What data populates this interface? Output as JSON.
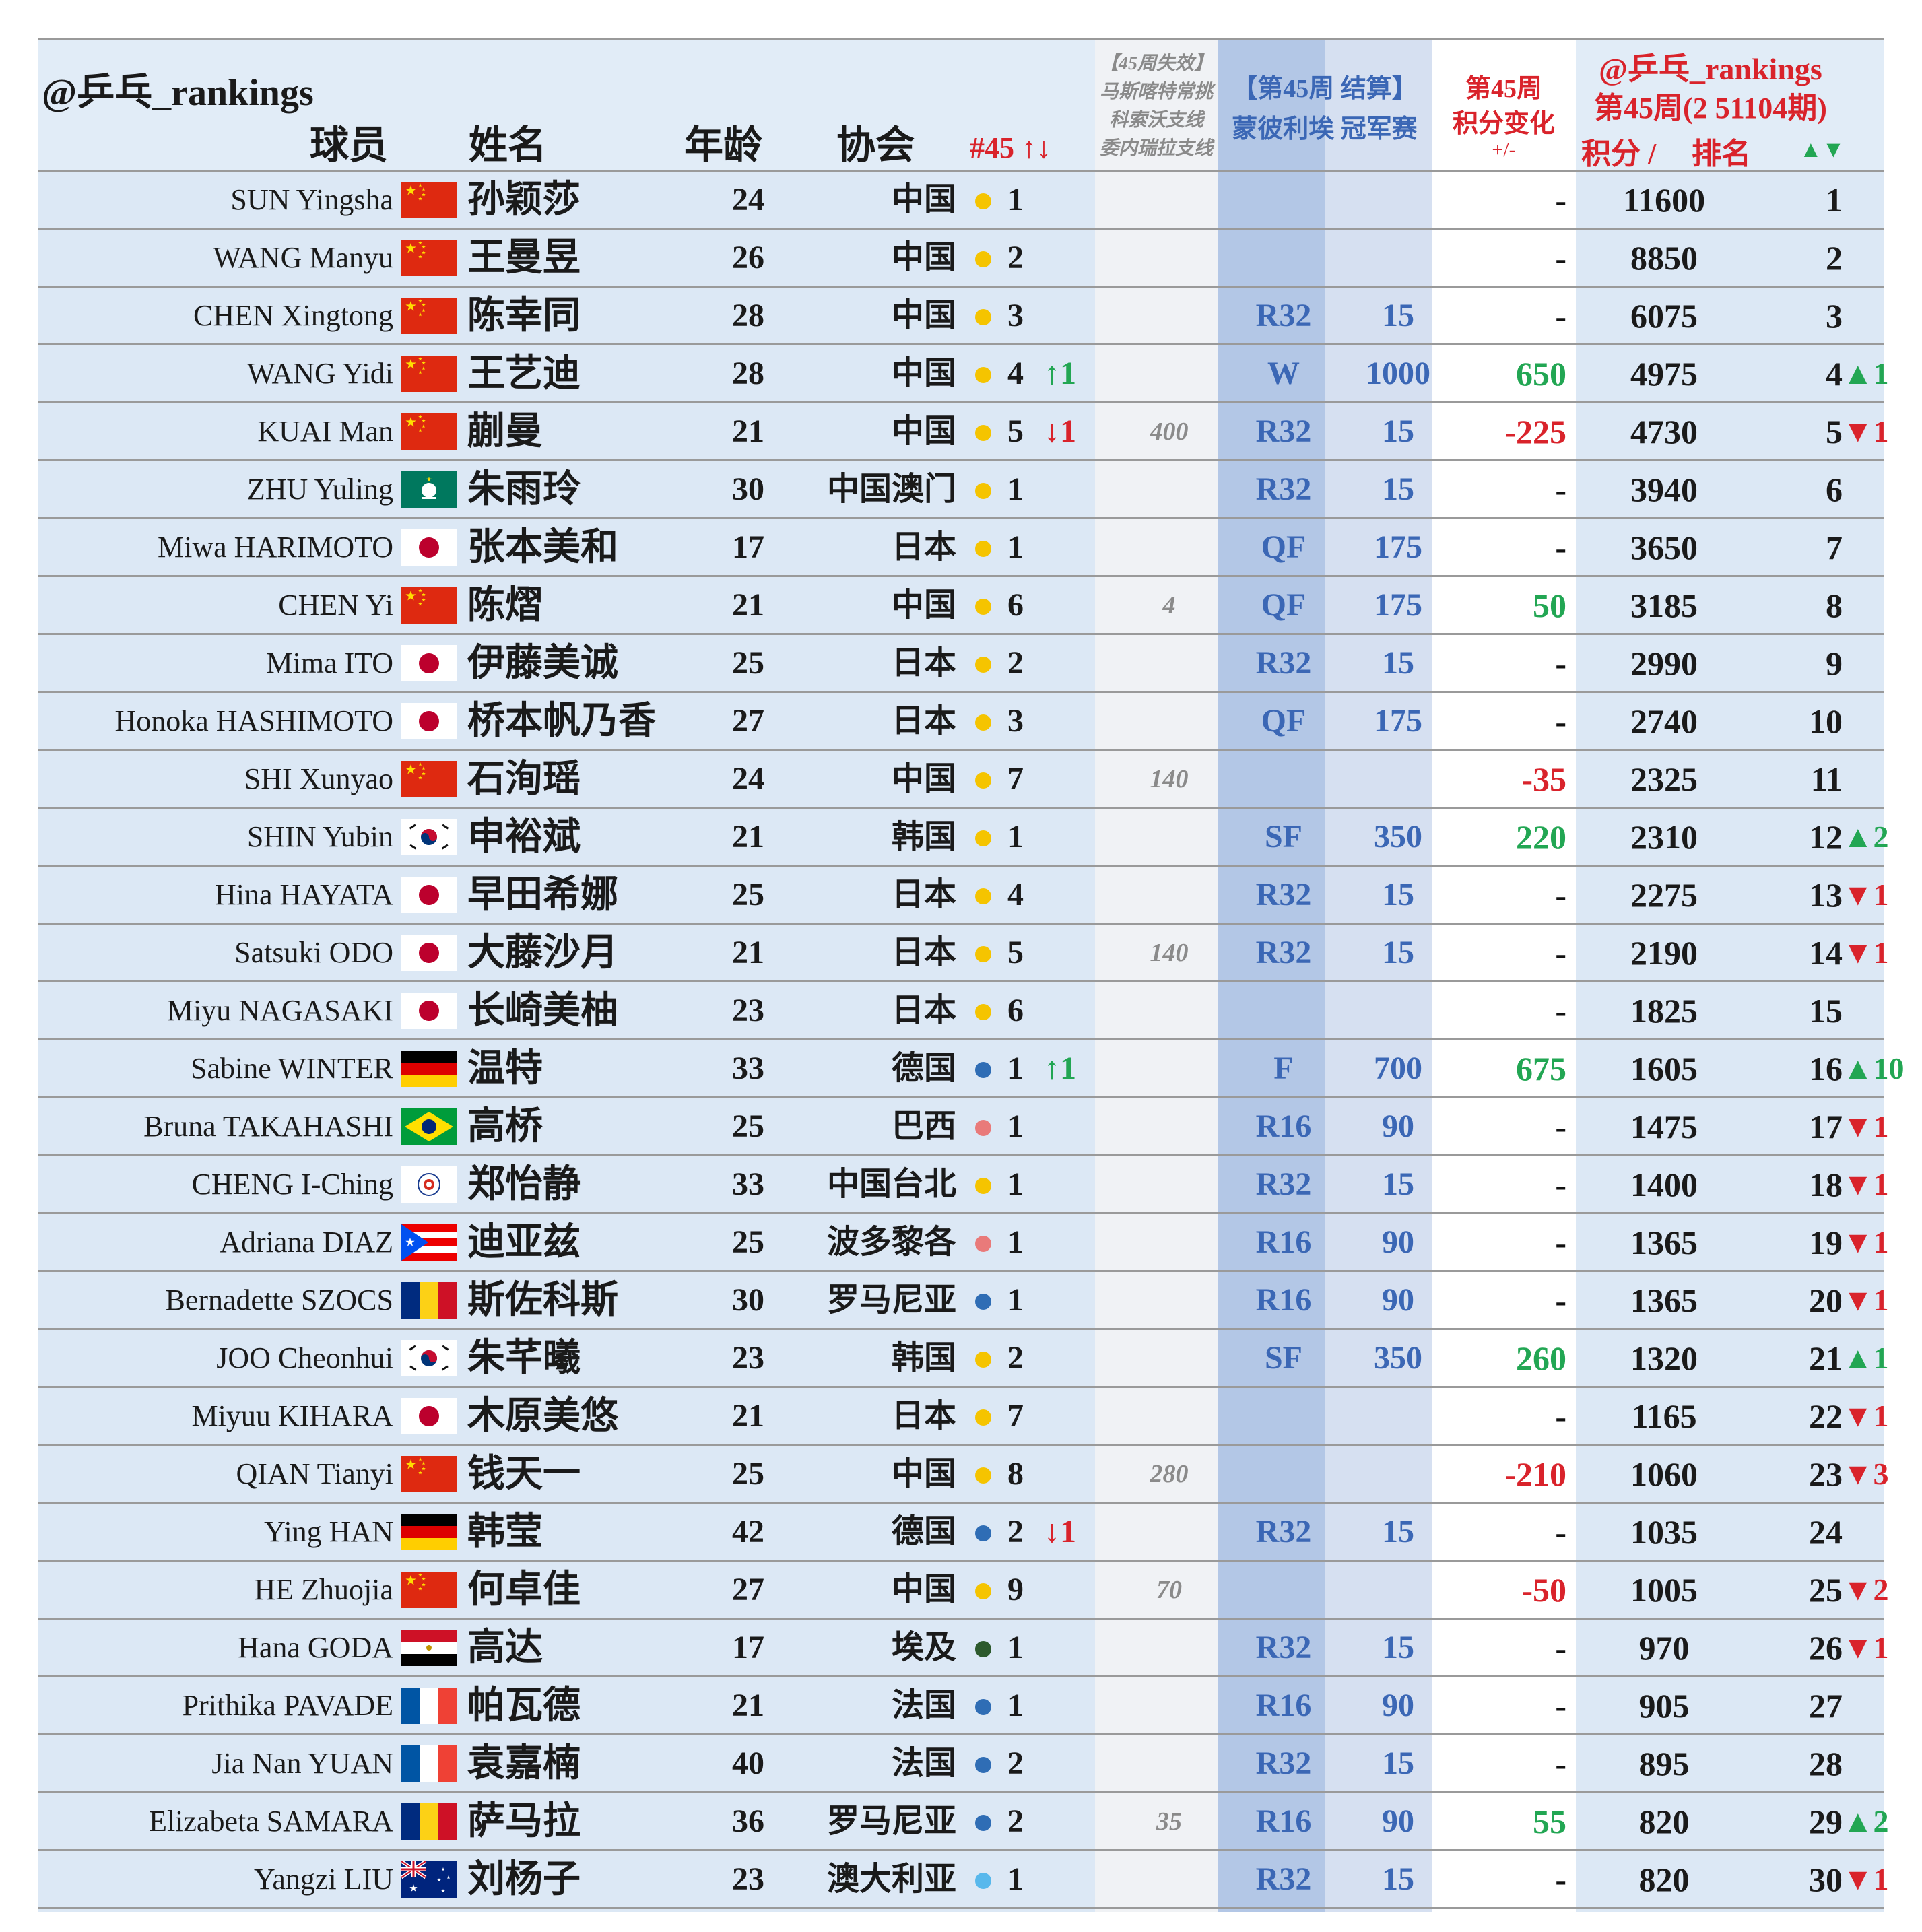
{
  "page": {
    "watermark_left": "@乒乓_rankings",
    "watermark_right": "@乒乓_rankings",
    "week_title": "第45周(2 51104期)"
  },
  "headers": {
    "player": "球员",
    "name": "姓名",
    "age": "年龄",
    "association": "协会",
    "national_rank": "#45 ↑↓",
    "expired_line1": "【45周失效】",
    "expired_line2": "马斯喀特常挑",
    "expired_line3": "科索沃支线",
    "expired_line4": "委内瑞拉支线",
    "event_line1": "【第45周 结算】",
    "event_line2": "蒙彼利埃 冠军赛",
    "change_line1": "第45周",
    "change_line2": "积分变化",
    "change_line3": "+/-",
    "points": "积分 /",
    "rank": "排名",
    "rank_change": "▲▼"
  },
  "colors": {
    "band": "#dce8f5",
    "header_band": "#e1ecf7",
    "expired_col": "#f0f2f5",
    "event_col_a": "#b3c7e6",
    "event_col_b": "#d6e0f1",
    "change_col": "#ffffff",
    "positive": "#22a653",
    "negative": "#d9232b",
    "result_blue": "#3b67b5"
  },
  "rows": [
    {
      "en": "SUN Yingsha",
      "flag": "china",
      "zh": "孙颖莎",
      "age": "24",
      "assoc": "中国",
      "dot": "#f5c400",
      "nrank": "1",
      "nchg": "",
      "nchg_dir": "",
      "expired": "",
      "result": "",
      "pts": "",
      "chg": "-",
      "chg_dir": "flat",
      "total": "11600",
      "rank": "1",
      "rchg": "",
      "rchg_dir": ""
    },
    {
      "en": "WANG Manyu",
      "flag": "china",
      "zh": "王曼昱",
      "age": "26",
      "assoc": "中国",
      "dot": "#f5c400",
      "nrank": "2",
      "nchg": "",
      "nchg_dir": "",
      "expired": "",
      "result": "",
      "pts": "",
      "chg": "-",
      "chg_dir": "flat",
      "total": "8850",
      "rank": "2",
      "rchg": "",
      "rchg_dir": ""
    },
    {
      "en": "CHEN Xingtong",
      "flag": "china",
      "zh": "陈幸同",
      "age": "28",
      "assoc": "中国",
      "dot": "#f5c400",
      "nrank": "3",
      "nchg": "",
      "nchg_dir": "",
      "expired": "",
      "result": "R32",
      "pts": "15",
      "chg": "-",
      "chg_dir": "flat",
      "total": "6075",
      "rank": "3",
      "rchg": "",
      "rchg_dir": ""
    },
    {
      "en": "WANG Yidi",
      "flag": "china",
      "zh": "王艺迪",
      "age": "28",
      "assoc": "中国",
      "dot": "#f5c400",
      "nrank": "4",
      "nchg": "↑1",
      "nchg_dir": "pos",
      "expired": "",
      "result": "W",
      "pts": "1000",
      "chg": "650",
      "chg_dir": "pos",
      "total": "4975",
      "rank": "4",
      "rchg": "▲1",
      "rchg_dir": "pos"
    },
    {
      "en": "KUAI Man",
      "flag": "china",
      "zh": "蒯曼",
      "age": "21",
      "assoc": "中国",
      "dot": "#f5c400",
      "nrank": "5",
      "nchg": "↓1",
      "nchg_dir": "neg",
      "expired": "400",
      "result": "R32",
      "pts": "15",
      "chg": "-225",
      "chg_dir": "neg",
      "total": "4730",
      "rank": "5",
      "rchg": "▼1",
      "rchg_dir": "neg"
    },
    {
      "en": "ZHU Yuling",
      "flag": "macau",
      "zh": "朱雨玲",
      "age": "30",
      "assoc": "中国澳门",
      "dot": "#f5c400",
      "nrank": "1",
      "nchg": "",
      "nchg_dir": "",
      "expired": "",
      "result": "R32",
      "pts": "15",
      "chg": "-",
      "chg_dir": "flat",
      "total": "3940",
      "rank": "6",
      "rchg": "",
      "rchg_dir": ""
    },
    {
      "en": "Miwa HARIMOTO",
      "flag": "japan",
      "zh": "张本美和",
      "age": "17",
      "assoc": "日本",
      "dot": "#f5c400",
      "nrank": "1",
      "nchg": "",
      "nchg_dir": "",
      "expired": "",
      "result": "QF",
      "pts": "175",
      "chg": "-",
      "chg_dir": "flat",
      "total": "3650",
      "rank": "7",
      "rchg": "",
      "rchg_dir": ""
    },
    {
      "en": "CHEN Yi",
      "flag": "china",
      "zh": "陈熠",
      "age": "21",
      "assoc": "中国",
      "dot": "#f5c400",
      "nrank": "6",
      "nchg": "",
      "nchg_dir": "",
      "expired": "4",
      "result": "QF",
      "pts": "175",
      "chg": "50",
      "chg_dir": "pos",
      "total": "3185",
      "rank": "8",
      "rchg": "",
      "rchg_dir": ""
    },
    {
      "en": "Mima ITO",
      "flag": "japan",
      "zh": "伊藤美诚",
      "age": "25",
      "assoc": "日本",
      "dot": "#f5c400",
      "nrank": "2",
      "nchg": "",
      "nchg_dir": "",
      "expired": "",
      "result": "R32",
      "pts": "15",
      "chg": "-",
      "chg_dir": "flat",
      "total": "2990",
      "rank": "9",
      "rchg": "",
      "rchg_dir": ""
    },
    {
      "en": "Honoka HASHIMOTO",
      "flag": "japan",
      "zh": "桥本帆乃香",
      "age": "27",
      "assoc": "日本",
      "dot": "#f5c400",
      "nrank": "3",
      "nchg": "",
      "nchg_dir": "",
      "expired": "",
      "result": "QF",
      "pts": "175",
      "chg": "-",
      "chg_dir": "flat",
      "total": "2740",
      "rank": "10",
      "rchg": "",
      "rchg_dir": ""
    },
    {
      "en": "SHI Xunyao",
      "flag": "china",
      "zh": "石洵瑶",
      "age": "24",
      "assoc": "中国",
      "dot": "#f5c400",
      "nrank": "7",
      "nchg": "",
      "nchg_dir": "",
      "expired": "140",
      "result": "",
      "pts": "",
      "chg": "-35",
      "chg_dir": "neg",
      "total": "2325",
      "rank": "11",
      "rchg": "",
      "rchg_dir": ""
    },
    {
      "en": "SHIN Yubin",
      "flag": "korea",
      "zh": "申裕斌",
      "age": "21",
      "assoc": "韩国",
      "dot": "#f5c400",
      "nrank": "1",
      "nchg": "",
      "nchg_dir": "",
      "expired": "",
      "result": "SF",
      "pts": "350",
      "chg": "220",
      "chg_dir": "pos",
      "total": "2310",
      "rank": "12",
      "rchg": "▲2",
      "rchg_dir": "pos"
    },
    {
      "en": "Hina HAYATA",
      "flag": "japan",
      "zh": "早田希娜",
      "age": "25",
      "assoc": "日本",
      "dot": "#f5c400",
      "nrank": "4",
      "nchg": "",
      "nchg_dir": "",
      "expired": "",
      "result": "R32",
      "pts": "15",
      "chg": "-",
      "chg_dir": "flat",
      "total": "2275",
      "rank": "13",
      "rchg": "▼1",
      "rchg_dir": "neg"
    },
    {
      "en": "Satsuki ODO",
      "flag": "japan",
      "zh": "大藤沙月",
      "age": "21",
      "assoc": "日本",
      "dot": "#f5c400",
      "nrank": "5",
      "nchg": "",
      "nchg_dir": "",
      "expired": "140",
      "result": "R32",
      "pts": "15",
      "chg": "-",
      "chg_dir": "flat",
      "total": "2190",
      "rank": "14",
      "rchg": "▼1",
      "rchg_dir": "neg"
    },
    {
      "en": "Miyu NAGASAKI",
      "flag": "japan",
      "zh": "长崎美柚",
      "age": "23",
      "assoc": "日本",
      "dot": "#f5c400",
      "nrank": "6",
      "nchg": "",
      "nchg_dir": "",
      "expired": "",
      "result": "",
      "pts": "",
      "chg": "-",
      "chg_dir": "flat",
      "total": "1825",
      "rank": "15",
      "rchg": "",
      "rchg_dir": ""
    },
    {
      "en": "Sabine WINTER",
      "flag": "germany",
      "zh": "温特",
      "age": "33",
      "assoc": "德国",
      "dot": "#2f6db5",
      "nrank": "1",
      "nchg": "↑1",
      "nchg_dir": "pos",
      "expired": "",
      "result": "F",
      "pts": "700",
      "chg": "675",
      "chg_dir": "pos",
      "total": "1605",
      "rank": "16",
      "rchg": "▲10",
      "rchg_dir": "pos"
    },
    {
      "en": "Bruna TAKAHASHI",
      "flag": "brazil",
      "zh": "高桥",
      "age": "25",
      "assoc": "巴西",
      "dot": "#e97a7a",
      "nrank": "1",
      "nchg": "",
      "nchg_dir": "",
      "expired": "",
      "result": "R16",
      "pts": "90",
      "chg": "-",
      "chg_dir": "flat",
      "total": "1475",
      "rank": "17",
      "rchg": "▼1",
      "rchg_dir": "neg"
    },
    {
      "en": "CHENG I-Ching",
      "flag": "tpe",
      "zh": "郑怡静",
      "age": "33",
      "assoc": "中国台北",
      "dot": "#f5c400",
      "nrank": "1",
      "nchg": "",
      "nchg_dir": "",
      "expired": "",
      "result": "R32",
      "pts": "15",
      "chg": "-",
      "chg_dir": "flat",
      "total": "1400",
      "rank": "18",
      "rchg": "▼1",
      "rchg_dir": "neg"
    },
    {
      "en": "Adriana DIAZ",
      "flag": "puertorico",
      "zh": "迪亚兹",
      "age": "25",
      "assoc": "波多黎各",
      "dot": "#e97a7a",
      "nrank": "1",
      "nchg": "",
      "nchg_dir": "",
      "expired": "",
      "result": "R16",
      "pts": "90",
      "chg": "-",
      "chg_dir": "flat",
      "total": "1365",
      "rank": "19",
      "rchg": "▼1",
      "rchg_dir": "neg"
    },
    {
      "en": "Bernadette SZOCS",
      "flag": "romania",
      "zh": "斯佐科斯",
      "age": "30",
      "assoc": "罗马尼亚",
      "dot": "#2f6db5",
      "nrank": "1",
      "nchg": "",
      "nchg_dir": "",
      "expired": "",
      "result": "R16",
      "pts": "90",
      "chg": "-",
      "chg_dir": "flat",
      "total": "1365",
      "rank": "20",
      "rchg": "▼1",
      "rchg_dir": "neg"
    },
    {
      "en": "JOO Cheonhui",
      "flag": "korea",
      "zh": "朱芊曦",
      "age": "23",
      "assoc": "韩国",
      "dot": "#f5c400",
      "nrank": "2",
      "nchg": "",
      "nchg_dir": "",
      "expired": "",
      "result": "SF",
      "pts": "350",
      "chg": "260",
      "chg_dir": "pos",
      "total": "1320",
      "rank": "21",
      "rchg": "▲1",
      "rchg_dir": "pos"
    },
    {
      "en": "Miyuu KIHARA",
      "flag": "japan",
      "zh": "木原美悠",
      "age": "21",
      "assoc": "日本",
      "dot": "#f5c400",
      "nrank": "7",
      "nchg": "",
      "nchg_dir": "",
      "expired": "",
      "result": "",
      "pts": "",
      "chg": "-",
      "chg_dir": "flat",
      "total": "1165",
      "rank": "22",
      "rchg": "▼1",
      "rchg_dir": "neg"
    },
    {
      "en": "QIAN Tianyi",
      "flag": "china",
      "zh": "钱天一",
      "age": "25",
      "assoc": "中国",
      "dot": "#f5c400",
      "nrank": "8",
      "nchg": "",
      "nchg_dir": "",
      "expired": "280",
      "result": "",
      "pts": "",
      "chg": "-210",
      "chg_dir": "neg",
      "total": "1060",
      "rank": "23",
      "rchg": "▼3",
      "rchg_dir": "neg"
    },
    {
      "en": "Ying HAN",
      "flag": "germany",
      "zh": "韩莹",
      "age": "42",
      "assoc": "德国",
      "dot": "#2f6db5",
      "nrank": "2",
      "nchg": "↓1",
      "nchg_dir": "neg",
      "expired": "",
      "result": "R32",
      "pts": "15",
      "chg": "-",
      "chg_dir": "flat",
      "total": "1035",
      "rank": "24",
      "rchg": "",
      "rchg_dir": ""
    },
    {
      "en": "HE Zhuojia",
      "flag": "china",
      "zh": "何卓佳",
      "age": "27",
      "assoc": "中国",
      "dot": "#f5c400",
      "nrank": "9",
      "nchg": "",
      "nchg_dir": "",
      "expired": "70",
      "result": "",
      "pts": "",
      "chg": "-50",
      "chg_dir": "neg",
      "total": "1005",
      "rank": "25",
      "rchg": "▼2",
      "rchg_dir": "neg"
    },
    {
      "en": "Hana GODA",
      "flag": "egypt",
      "zh": "高达",
      "age": "17",
      "assoc": "埃及",
      "dot": "#2d5a2d",
      "nrank": "1",
      "nchg": "",
      "nchg_dir": "",
      "expired": "",
      "result": "R32",
      "pts": "15",
      "chg": "-",
      "chg_dir": "flat",
      "total": "970",
      "rank": "26",
      "rchg": "▼1",
      "rchg_dir": "neg"
    },
    {
      "en": "Prithika PAVADE",
      "flag": "france",
      "zh": "帕瓦德",
      "age": "21",
      "assoc": "法国",
      "dot": "#2f6db5",
      "nrank": "1",
      "nchg": "",
      "nchg_dir": "",
      "expired": "",
      "result": "R16",
      "pts": "90",
      "chg": "-",
      "chg_dir": "flat",
      "total": "905",
      "rank": "27",
      "rchg": "",
      "rchg_dir": ""
    },
    {
      "en": "Jia Nan YUAN",
      "flag": "france",
      "zh": "袁嘉楠",
      "age": "40",
      "assoc": "法国",
      "dot": "#2f6db5",
      "nrank": "2",
      "nchg": "",
      "nchg_dir": "",
      "expired": "",
      "result": "R32",
      "pts": "15",
      "chg": "-",
      "chg_dir": "flat",
      "total": "895",
      "rank": "28",
      "rchg": "",
      "rchg_dir": ""
    },
    {
      "en": "Elizabeta SAMARA",
      "flag": "romania",
      "zh": "萨马拉",
      "age": "36",
      "assoc": "罗马尼亚",
      "dot": "#2f6db5",
      "nrank": "2",
      "nchg": "",
      "nchg_dir": "",
      "expired": "35",
      "result": "R16",
      "pts": "90",
      "chg": "55",
      "chg_dir": "pos",
      "total": "820",
      "rank": "29",
      "rchg": "▲2",
      "rchg_dir": "pos"
    },
    {
      "en": "Yangzi LIU",
      "flag": "australia",
      "zh": "刘杨子",
      "age": "23",
      "assoc": "澳大利亚",
      "dot": "#58b8ec",
      "nrank": "1",
      "nchg": "",
      "nchg_dir": "",
      "expired": "",
      "result": "R32",
      "pts": "15",
      "chg": "-",
      "chg_dir": "flat",
      "total": "820",
      "rank": "30",
      "rchg": "▼1",
      "rchg_dir": "neg"
    }
  ]
}
